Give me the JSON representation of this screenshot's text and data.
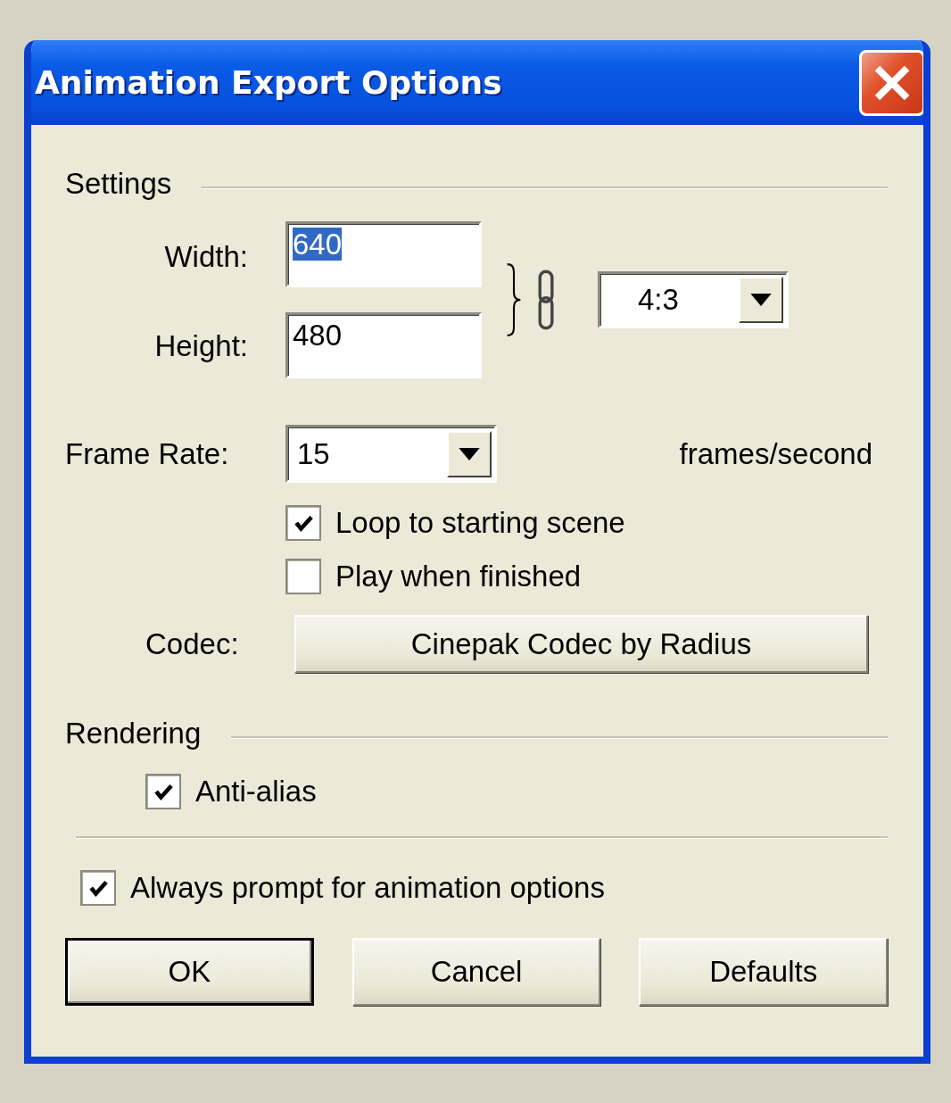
{
  "window": {
    "title": "Animation Export Options"
  },
  "settings": {
    "heading": "Settings",
    "width": {
      "label": "Width:",
      "value": "640",
      "selected": true
    },
    "height": {
      "label": "Height:",
      "value": "480",
      "selected": false
    },
    "aspect_ratio": "4:3",
    "frame_rate": {
      "label": "Frame Rate:",
      "value": "15",
      "unit": "frames/second"
    },
    "options": [
      {
        "label": "Loop to starting scene",
        "checked": true
      },
      {
        "label": "Play when finished",
        "checked": false
      }
    ],
    "codec": {
      "label": "Codec:",
      "button": "Cinepak Codec by Radius"
    }
  },
  "rendering": {
    "heading": "Rendering",
    "options": [
      {
        "label": "Anti-alias",
        "checked": true
      }
    ]
  },
  "always_prompt": {
    "label": "Always prompt for animation options",
    "checked": true
  },
  "buttons": [
    {
      "label": "OK",
      "default": true
    },
    {
      "label": "Cancel",
      "default": false
    },
    {
      "label": "Defaults",
      "default": false
    }
  ]
}
